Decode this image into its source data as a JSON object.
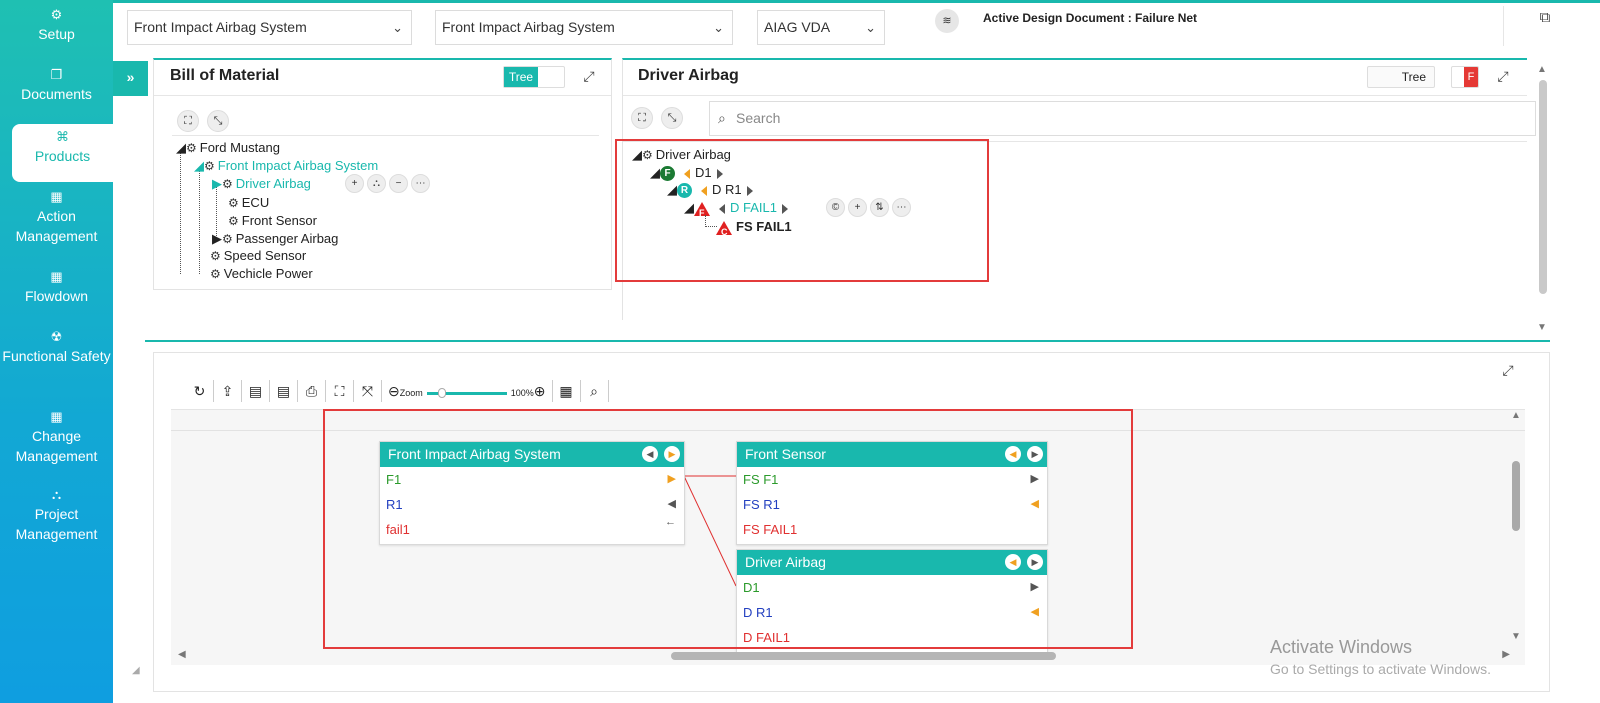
{
  "sidebar": {
    "items": [
      {
        "label": "Setup",
        "icon": "gears-icon"
      },
      {
        "label": "Documents",
        "icon": "documents-icon"
      },
      {
        "label": "Products",
        "icon": "products-icon",
        "active": true
      },
      {
        "label": "Action Management",
        "icon": "building-icon"
      },
      {
        "label": "Flowdown",
        "icon": "building-icon"
      },
      {
        "label": "Functional Safety",
        "icon": "safety-icon"
      },
      {
        "label": "Change Management",
        "icon": "building-icon"
      },
      {
        "label": "Project Management",
        "icon": "hierarchy-icon"
      }
    ]
  },
  "topbar": {
    "select1": "Front Impact Airbag System",
    "select2": "Front Impact Airbag System",
    "select3": "AIAG VDA",
    "active_doc": "Active Design Document : Failure Net"
  },
  "bom": {
    "title": "Bill of Material",
    "toggle_label": "Tree",
    "tree": [
      "Ford Mustang",
      "Front Impact Airbag System",
      "Driver Airbag",
      "ECU",
      "Front Sensor",
      "Passenger Airbag",
      "Speed Sensor",
      "Vechicle Power"
    ]
  },
  "detail": {
    "title": "Driver Airbag",
    "toggle_label": "Tree",
    "f_badge": "F",
    "search_placeholder": "Search",
    "tree": {
      "root": "Driver Airbag",
      "f_label": "D1",
      "r_label": "D R1",
      "fail_label": "D FAIL1",
      "child_fail": "FS FAIL1",
      "badge_f": "F",
      "badge_r": "R",
      "badge_c": "C"
    }
  },
  "canvas": {
    "zoom_label": "Zoom",
    "zoom_value": "100%",
    "zoom_fraction": 0.15,
    "cards": [
      {
        "title": "Front Impact Airbag System",
        "rows": [
          "F1",
          "R1",
          "fail1"
        ]
      },
      {
        "title": "Front  Sensor",
        "rows": [
          "FS F1",
          "FS R1",
          "FS FAIL1"
        ]
      },
      {
        "title": "Driver Airbag",
        "rows": [
          "D1",
          "D R1",
          "D FAIL1"
        ]
      }
    ]
  },
  "watermark": {
    "line1": "Activate Windows",
    "line2": "Go to Settings to activate Windows."
  },
  "colors": {
    "accent": "#19b8ad",
    "highlight": "#e33b3b",
    "function": "#2b9a2b",
    "requirement": "#2340c0",
    "failure": "#e03030"
  }
}
